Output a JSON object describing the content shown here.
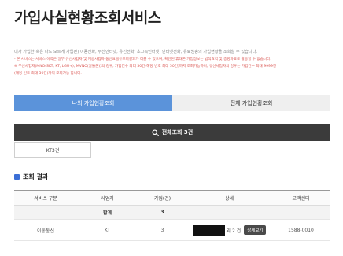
{
  "page": {
    "title": "가입사실현황조회서비스"
  },
  "notice": {
    "line1": "내가 가입한(혹은 나도 모르게 가입된) 이동전화, 무선인터넷, 유선전화, 초고속인터넷, 인터넷전화, 유료방송의 가입현황을 조회할 수 있습니다.",
    "line2": "- 본 서비스는 서비스 이력은 일부 유선사업자 및 계공사업자 통신요금유조회결과가 다를 수 있으며, 확인된 휴대폰 가입정보는 법적효력 및 증명자료로 활용할 수 없습니다.",
    "line3": "※ 무선사업자(MNO(SKT, KT, LGU+), MVNO(알뜰폰))의 경우, 가입건수 최대 50건(해당 번호 최대 50건)까지 조회가능하나, 유선사업자의 경우는 가입건수 최대 9999건",
    "line4": "(해당 번호 최대 50건)까지 조회가능 합니다."
  },
  "tabs": [
    {
      "label": "나의 가입현황조회"
    },
    {
      "label": "전체 가입현황조회"
    }
  ],
  "search": {
    "label": "전체조회 3건"
  },
  "filter_chip": {
    "label": "KT3건"
  },
  "results": {
    "title": "조회 결과",
    "columns": [
      "서비스 구분",
      "사업자",
      "가입(건)",
      "상세",
      "고객센터"
    ],
    "summary": {
      "label": "합계",
      "count": "3"
    },
    "rows": [
      {
        "service": "이동통신",
        "provider": "KT",
        "count": "3",
        "detail_suffix": "외 2 건",
        "detail_button": "상세보기",
        "center": "1588-0010"
      }
    ]
  },
  "colors": {
    "accent": "#5b93da",
    "dark": "#3b3b3b",
    "section_icon": "#3b6fd6",
    "notice_red": "#d9534f"
  }
}
